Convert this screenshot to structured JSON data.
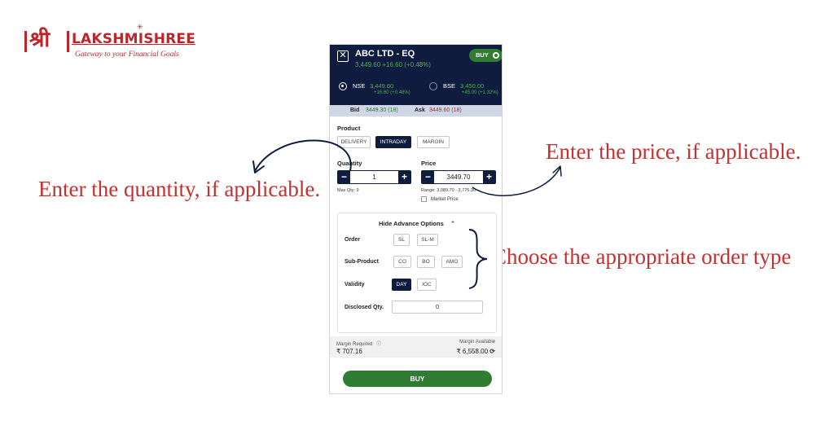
{
  "logo": {
    "mark": "श्री",
    "name": "LAKSHMISHREE",
    "tagline": "Gateway to your Financial Goals"
  },
  "annotations": {
    "quantity": "Enter the quantity, if applicable.",
    "price": "Enter the price, if applicable.",
    "order_type": "Choose the appropriate order type"
  },
  "order_panel": {
    "symbol": "ABC LTD - EQ",
    "price_line": "3,449.60  +16.60 (+0.48%)",
    "buy_pill": "BUY",
    "exchanges": [
      {
        "name": "NSE",
        "price": "3,449.60",
        "change": "+16.60 (+0.48%)",
        "selected": true
      },
      {
        "name": "BSE",
        "price": "3,450.00",
        "change": "+45.00 (+1.32%)",
        "selected": false
      }
    ],
    "bid_label": "Bid",
    "bid_value": "3449.30 (18)",
    "ask_label": "Ask",
    "ask_value": "3449.60 (18)",
    "product_label": "Product",
    "products": [
      "DELIVERY",
      "INTRADAY",
      "MARGIN"
    ],
    "selected_product": "INTRADAY",
    "quantity_label": "Quantity",
    "quantity_value": "1",
    "max_qty": "Max Qty: 9",
    "price_label": "Price",
    "price_value": "3449.70",
    "range": "Range: 3,089.70 - 3,776.30",
    "market_price_label": "Market Price",
    "advance_toggle": "Hide Advance Options",
    "order_label": "Order",
    "order_types": [
      "SL",
      "SL-M"
    ],
    "subproduct_label": "Sub-Product",
    "subproducts": [
      "CO",
      "BO",
      "AMO"
    ],
    "validity_label": "Validity",
    "validity": [
      "DAY",
      "IOC"
    ],
    "selected_validity": "DAY",
    "disclosed_label": "Disclosed Qty.",
    "disclosed_value": "0",
    "margin_required_label": "Margin Required",
    "margin_required_value": "₹ 707.16",
    "margin_available_label": "Margin Available",
    "margin_available_value": "₹ 6,558.00",
    "buy_button": "BUY"
  },
  "colors": {
    "brand_red": "#c0242b",
    "navy": "#0f1c3f",
    "green": "#2e7d32"
  }
}
